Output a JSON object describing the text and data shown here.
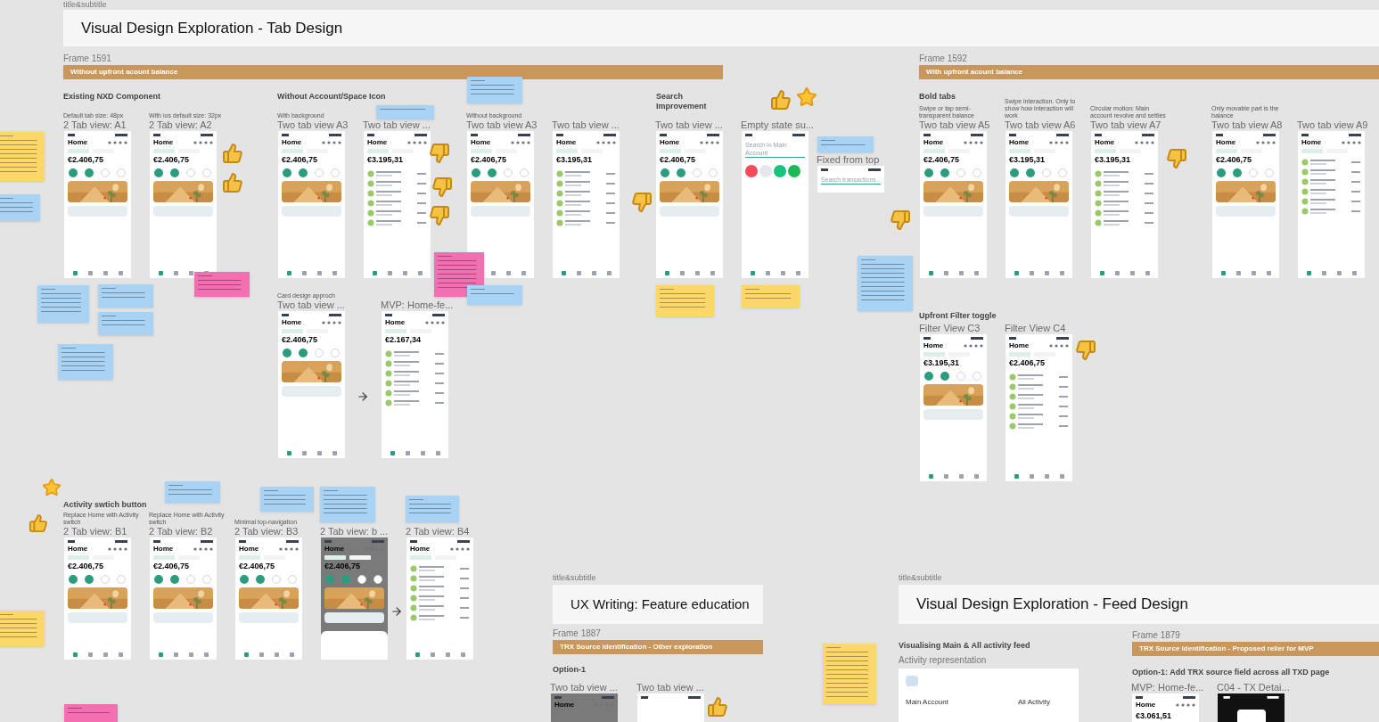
{
  "title_blocks": [
    {
      "caption": "title&subtitle",
      "title": "Visual Design Exploration - Tab Design"
    },
    {
      "caption": "title&subtitle",
      "title": "UX Writing: Feature education"
    },
    {
      "caption": "title&subtitle",
      "title": "Visual Design Exploration - Feed Design"
    }
  ],
  "frames": [
    {
      "name": "Frame 1591",
      "banner": "Without upfront acount balance"
    },
    {
      "name": "Frame 1592",
      "banner": "With upfront acount balance"
    },
    {
      "name": "Frame 1887",
      "banner": "TRX Source identification - Other exploration"
    },
    {
      "name": "Frame 1879",
      "banner": "TRX Source identification - Proposed relier for MVP"
    }
  ],
  "section_headings": [
    "Existing NXD Component",
    "Without Account/Space Icon",
    "Search Improvement",
    "Bold tabs",
    "Upfront Filter toggle",
    "Activity swtich button",
    "Option-1",
    "Visualising Main & All activity feed",
    "Option-1: Add TRX source field across all TXD page"
  ],
  "phones": [
    {
      "label": "2 Tab view: A1",
      "caption": "Default tab size: 48px",
      "kind": "home",
      "title": "Home",
      "balance": "€2.406,75"
    },
    {
      "label": "2 Tab view: A2",
      "caption": "With ios default size: 32px",
      "kind": "home",
      "title": "Home",
      "balance": "€2.406,75"
    },
    {
      "label": "Two tab view A3",
      "caption": "With background",
      "kind": "home",
      "title": "Home",
      "balance": "€2.406,75"
    },
    {
      "label": "Two tab view ...",
      "kind": "list",
      "title": "Home",
      "balance": "€3.195,31"
    },
    {
      "label": "Two tab view A3",
      "caption": "Without background",
      "kind": "home",
      "title": "Home",
      "balance": "€2.406,75"
    },
    {
      "label": "Two tab view ...",
      "kind": "list",
      "title": "Home",
      "balance": "€3.195,31"
    },
    {
      "label": "Two tab view ...",
      "kind": "home",
      "title": "Home",
      "balance": "€2.406,75"
    },
    {
      "label": "Empty state su...",
      "kind": "search",
      "placeholder": "Search in Main Account"
    },
    {
      "label": "Fixed from top",
      "kind": "fixed",
      "placeholder": "Search transactions"
    },
    {
      "label": "Two tab view A5",
      "caption": "Swipe or tap semi-transparent balance",
      "kind": "home",
      "title": "Home",
      "balance": "€2.406,75"
    },
    {
      "label": "Two tab view A6",
      "caption": "Swipe interaction. Only to show how interaction will work",
      "kind": "home",
      "title": "Home",
      "balance": "€3.195,31"
    },
    {
      "label": "Two tab view A7",
      "caption": "Circular motion: Main account revolve and settles",
      "kind": "list",
      "title": "Home",
      "balance": "€3.195,31"
    },
    {
      "label": "Two tab view A8",
      "caption": "Only movable part is the balance",
      "kind": "home",
      "title": "Home",
      "balance": "€2.406,75"
    },
    {
      "label": "Two tab view A9",
      "kind": "list",
      "title": "Home"
    },
    {
      "label": "Two tab view ...",
      "caption": "Card design approch",
      "kind": "home",
      "title": "Home",
      "balance": "€2.406,75"
    },
    {
      "label": "MVP: Home-fe...",
      "kind": "list",
      "title": "Home",
      "balance": "€2.167,34"
    },
    {
      "label": "Filter View C3",
      "kind": "home",
      "title": "Home",
      "balance": "€3.195,31"
    },
    {
      "label": "Filter View C4",
      "kind": "list",
      "title": "Home",
      "balance": "€2.406,75"
    },
    {
      "label": "2 Tab view: B1",
      "caption": "Replace Home with Activity switch",
      "kind": "home",
      "title": "Home",
      "balance": "€2.406,75"
    },
    {
      "label": "2 Tab view: B2",
      "caption": "Replace Home with Activity switch",
      "kind": "home",
      "title": "Home",
      "balance": "€2.406,75"
    },
    {
      "label": "2 Tab view: B3",
      "caption": "Minimal top-navigation",
      "kind": "home",
      "title": "Home",
      "balance": "€2.406,75"
    },
    {
      "label": "2 Tab view: b ...",
      "kind": "dim",
      "title": "Home",
      "balance": "€2.406,75"
    },
    {
      "label": "2 Tab view: B4",
      "kind": "list",
      "title": "Home"
    },
    {
      "label": "Two tab view ...",
      "kind": "dim",
      "title": "Home"
    },
    {
      "label": "Two tab view ...",
      "kind": "home"
    },
    {
      "label": "MVP: Home-fe...",
      "kind": "home",
      "title": "Home",
      "balance": "€3.061,51"
    },
    {
      "label": "C04 - TX Detai...",
      "kind": "detail"
    }
  ],
  "feed_card": {
    "caption": "Activity representation",
    "left": "Main Account",
    "right": "All Activity"
  },
  "stickies": [
    {
      "color": "#fcd86b"
    },
    {
      "color": "#a8d3f4"
    },
    {
      "color": "#a8d3f4"
    },
    {
      "color": "#a8d3f4"
    },
    {
      "color": "#a8d3f4"
    },
    {
      "color": "#a8d3f4"
    },
    {
      "color": "#f26fb2"
    },
    {
      "color": "#f26fb2"
    },
    {
      "color": "#a8d3f4"
    },
    {
      "color": "#a8d3f4"
    },
    {
      "color": "#a8d3f4"
    },
    {
      "color": "#fcd86b"
    },
    {
      "color": "#fcd86b"
    },
    {
      "color": "#a8d3f4"
    },
    {
      "color": "#a8d3f4"
    },
    {
      "color": "#fcd86b"
    },
    {
      "color": "#a8d3f4"
    },
    {
      "color": "#a8d3f4"
    },
    {
      "color": "#a8d3f4"
    },
    {
      "color": "#a8d3f4"
    },
    {
      "color": "#fcd86b"
    },
    {
      "color": "#f26fb2"
    }
  ],
  "reactions": [
    {
      "kind": "up"
    },
    {
      "kind": "up"
    },
    {
      "kind": "down"
    },
    {
      "kind": "down"
    },
    {
      "kind": "down"
    },
    {
      "kind": "down"
    },
    {
      "kind": "up"
    },
    {
      "kind": "star"
    },
    {
      "kind": "down"
    },
    {
      "kind": "down"
    },
    {
      "kind": "down"
    },
    {
      "kind": "star"
    },
    {
      "kind": "up"
    },
    {
      "kind": "up"
    }
  ]
}
